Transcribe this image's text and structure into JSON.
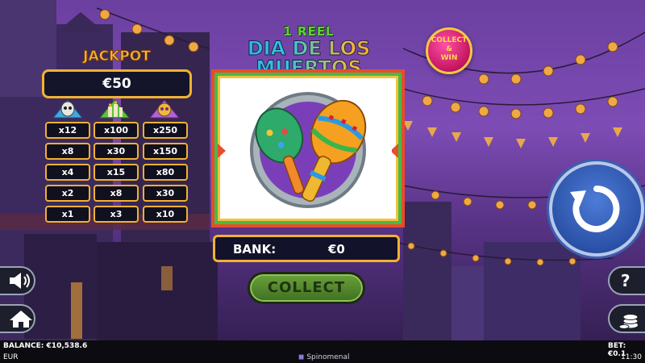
{
  "title": {
    "line1": "1 REEL",
    "line2": "DIA DE LOS MUERTOS"
  },
  "badge": {
    "line1": "COLLECT",
    "line2": "&",
    "line3": "WIN"
  },
  "jackpot": {
    "label": "JACKPOT",
    "value": "€50",
    "columns": [
      {
        "icon": "skull-icon",
        "values": [
          "x12",
          "x8",
          "x4",
          "x2",
          "x1"
        ]
      },
      {
        "icon": "candles-icon",
        "values": [
          "x100",
          "x30",
          "x15",
          "x8",
          "x3"
        ]
      },
      {
        "icon": "flower-skull-icon",
        "values": [
          "x250",
          "x150",
          "x80",
          "x30",
          "x10"
        ]
      }
    ]
  },
  "reel": {
    "symbol": "maracas-icon"
  },
  "bank": {
    "label": "BANK:",
    "value": "€0"
  },
  "buttons": {
    "collect": "COLLECT",
    "help": "?"
  },
  "status": {
    "balance": "BALANCE: €10,538.6",
    "currency": "EUR",
    "provider": "Spinomenal",
    "bet": "BET: €0.1",
    "time": "11:30"
  },
  "colors": {
    "gold": "#f1b132",
    "spin_blue": "#2b52a8",
    "collect_green": "#4f8a2c"
  }
}
